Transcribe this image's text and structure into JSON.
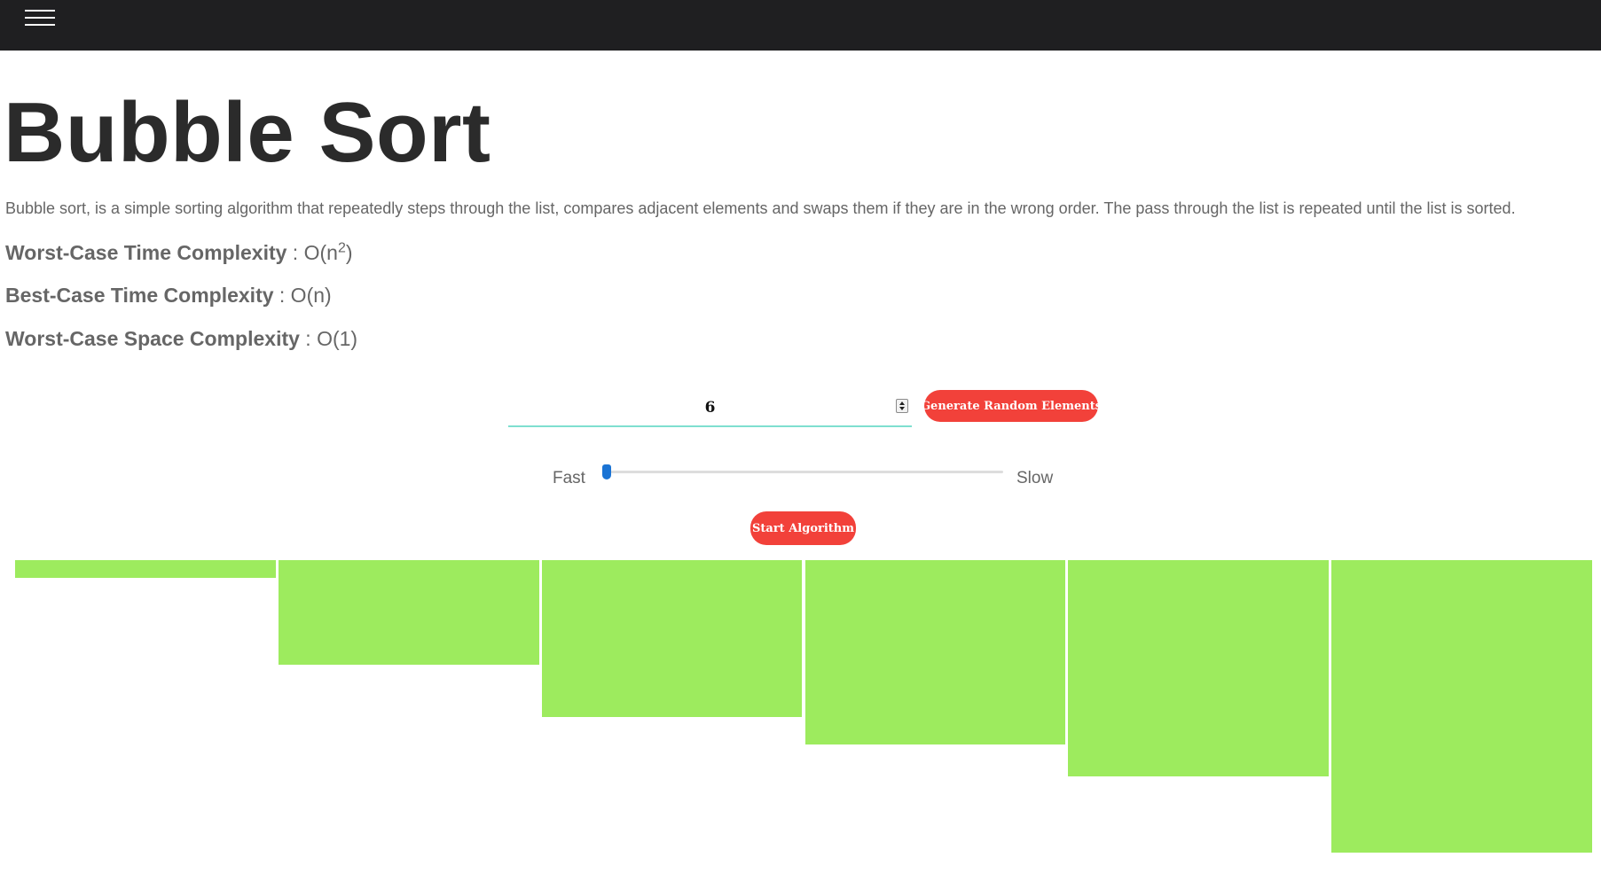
{
  "topbar": {
    "menu_icon": "hamburger-menu-icon"
  },
  "page": {
    "title": "Bubble Sort",
    "description": "Bubble sort, is a simple sorting algorithm that repeatedly steps through the list, compares adjacent elements and swaps them if they are in the wrong order. The pass through the list is repeated until the list is sorted."
  },
  "complexity": {
    "worst_time": {
      "label": "Worst-Case Time Complexity",
      "value_prefix": " : O(n",
      "value_sup": "2",
      "value_suffix": ")"
    },
    "best_time": {
      "label": "Best-Case Time Complexity",
      "value": " : O(n)"
    },
    "worst_space": {
      "label": "Worst-Case Space Complexity",
      "value": " : O(1)"
    }
  },
  "controls": {
    "element_count": "6",
    "generate_label": "Generate Random Elements",
    "speed_fast_label": "Fast",
    "speed_slow_label": "Slow",
    "speed_value": 0,
    "start_label": "Start Algorithm"
  },
  "array": {
    "values": [
      5,
      30,
      45,
      53,
      62,
      84
    ],
    "bar_color": "#9deb5e"
  },
  "colors": {
    "accent": "#f2413a",
    "topbar": "#1f1f21",
    "input_underline": "#7fdfd0",
    "slider_thumb": "#1a73d4"
  }
}
